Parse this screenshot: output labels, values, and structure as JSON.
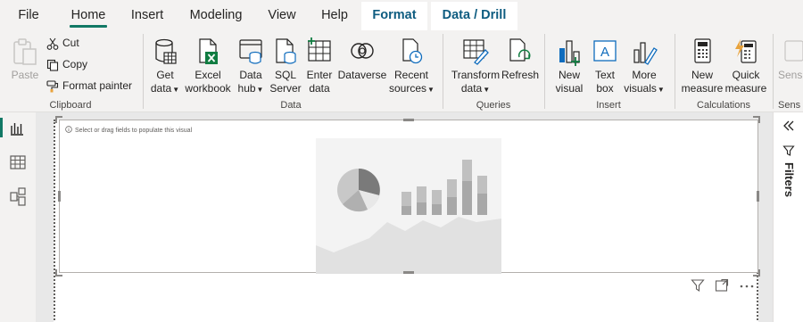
{
  "menu": {
    "tabs": [
      {
        "label": "File"
      },
      {
        "label": "Home"
      },
      {
        "label": "Insert"
      },
      {
        "label": "Modeling"
      },
      {
        "label": "View"
      },
      {
        "label": "Help"
      },
      {
        "label": "Format"
      },
      {
        "label": "Data / Drill"
      }
    ],
    "active": "Home"
  },
  "ribbon": {
    "clipboard": {
      "paste": "Paste",
      "cut": "Cut",
      "copy": "Copy",
      "format_painter": "Format painter",
      "group": "Clipboard"
    },
    "data": {
      "get_data_1": "Get",
      "get_data_2": "data",
      "excel_1": "Excel",
      "excel_2": "workbook",
      "hub_1": "Data",
      "hub_2": "hub",
      "sql_1": "SQL",
      "sql_2": "Server",
      "enter_1": "Enter",
      "enter_2": "data",
      "dataverse": "Dataverse",
      "recent_1": "Recent",
      "recent_2": "sources",
      "group": "Data"
    },
    "queries": {
      "transform_1": "Transform",
      "transform_2": "data",
      "refresh": "Refresh",
      "group": "Queries"
    },
    "insert": {
      "new_visual_1": "New",
      "new_visual_2": "visual",
      "text_box_1": "Text",
      "text_box_2": "box",
      "more_1": "More",
      "more_2": "visuals",
      "group": "Insert"
    },
    "calculations": {
      "new_measure_1": "New",
      "new_measure_2": "measure",
      "quick_1": "Quick",
      "quick_2": "measure",
      "group": "Calculations"
    },
    "sensitivity": {
      "label": "Sens",
      "group": "Sens"
    }
  },
  "visual": {
    "placeholder": "Select or drag fields to populate this visual"
  },
  "right_pane": {
    "filters": "Filters"
  },
  "colors": {
    "accent": "#117865",
    "context_tab": "#0e5c80",
    "icon_blue": "#0f6cbd",
    "excel_green": "#107c41",
    "quick_measure_orange": "#e8a33d"
  }
}
